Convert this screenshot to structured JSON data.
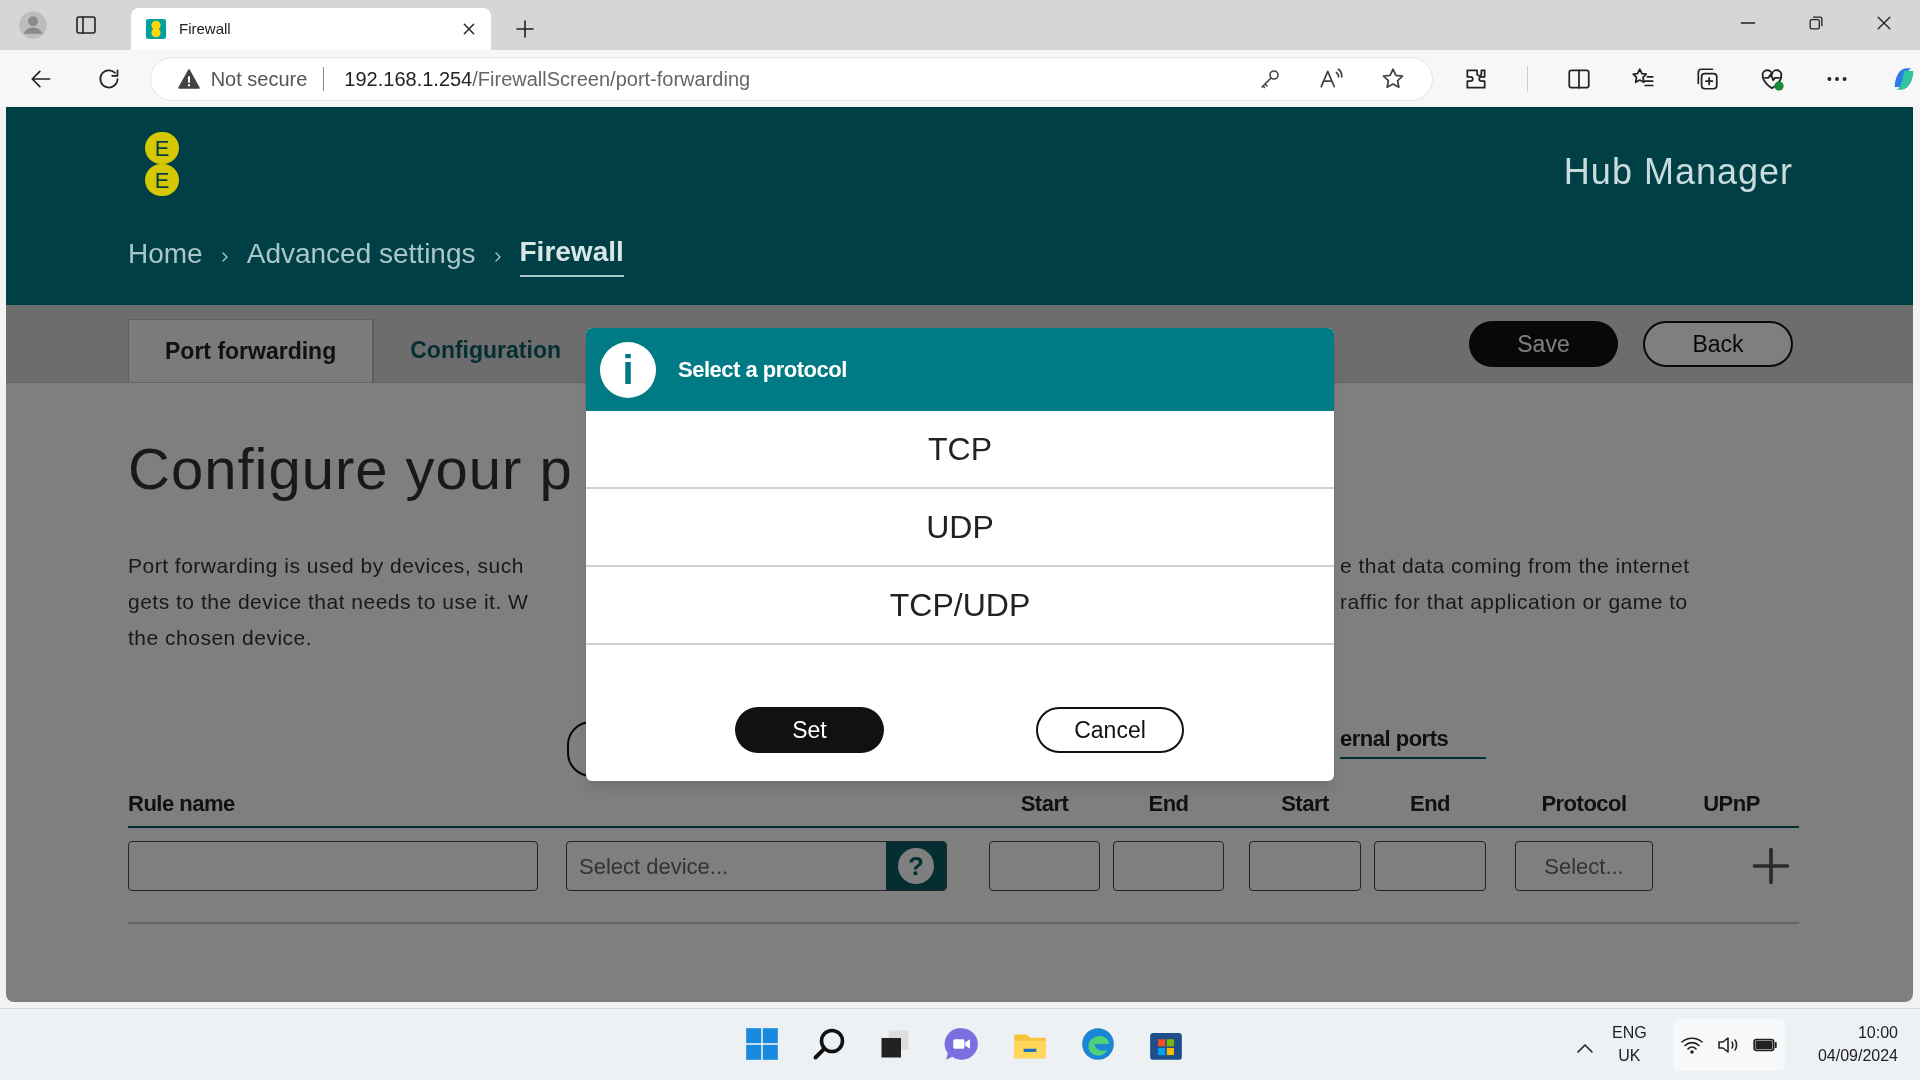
{
  "browser": {
    "tab_title": "Firewall",
    "security_label": "Not secure",
    "url_host": "192.168.1.254",
    "url_path": "/FirewallScreen/port-forwarding"
  },
  "header": {
    "logo_letters": [
      "E",
      "E"
    ],
    "title": "Hub Manager",
    "breadcrumb": [
      {
        "label": "Home",
        "current": false
      },
      {
        "label": "Advanced settings",
        "current": false
      },
      {
        "label": "Firewall",
        "current": true
      }
    ]
  },
  "tabs": [
    {
      "label": "Port forwarding",
      "selected": true
    },
    {
      "label": "Configuration",
      "selected": false
    }
  ],
  "actions": [
    {
      "label": "Save",
      "kind": "primary"
    },
    {
      "label": "Back",
      "kind": "secondary"
    }
  ],
  "heading": "Configure your p",
  "description": {
    "left_lines": [
      "Port forwarding is used by devices, such",
      "gets to the device that needs to use it. W",
      "the chosen device."
    ],
    "right_lines": [
      "e that data coming from the internet",
      "raffic for that application or game to"
    ]
  },
  "table": {
    "group_label": "ernal ports",
    "columns": [
      "Rule name",
      "Start",
      "End",
      "Start",
      "End",
      "Protocol",
      "UPnP"
    ],
    "row": [
      {
        "kind": "text"
      },
      {
        "kind": "device",
        "placeholder": "Select device...",
        "help": "?"
      },
      {
        "kind": "text"
      },
      {
        "kind": "text"
      },
      {
        "kind": "text"
      },
      {
        "kind": "text"
      },
      {
        "kind": "select",
        "placeholder": "Select..."
      },
      {
        "kind": "add"
      }
    ]
  },
  "modal": {
    "title": "Select a protocol",
    "info_glyph": "i",
    "options": [
      {
        "label": "TCP",
        "selected": false
      },
      {
        "label": "UDP",
        "selected": false
      },
      {
        "label": "TCP/UDP",
        "selected": false
      }
    ],
    "buttons": [
      {
        "label": "Set",
        "kind": "primary"
      },
      {
        "label": "Cancel",
        "kind": "secondary"
      }
    ]
  },
  "taskbar": {
    "language": [
      "ENG",
      "UK"
    ],
    "time": "10:00",
    "date": "04/09/2024"
  }
}
